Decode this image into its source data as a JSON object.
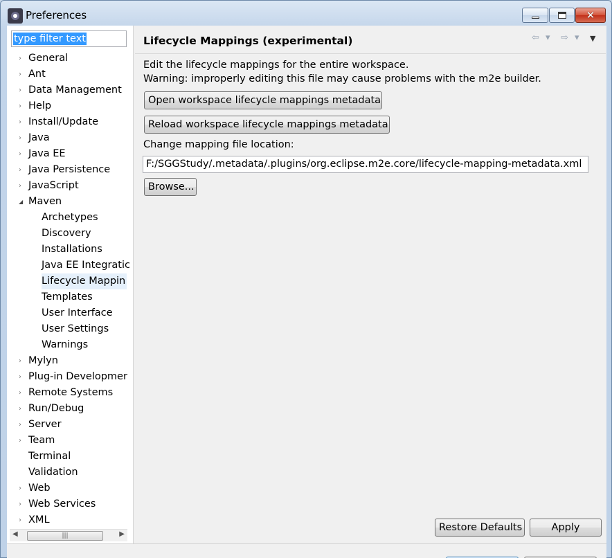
{
  "window": {
    "title": "Preferences",
    "min_icon": "minimize-icon",
    "max_icon": "maximize-icon",
    "close_icon": "close-icon",
    "close_glyph": "✕"
  },
  "filter": {
    "value": "type filter text"
  },
  "tree": {
    "items": [
      {
        "label": "General",
        "expander": "›",
        "child": false
      },
      {
        "label": "Ant",
        "expander": "›",
        "child": false
      },
      {
        "label": "Data Management",
        "expander": "›",
        "child": false
      },
      {
        "label": "Help",
        "expander": "›",
        "child": false
      },
      {
        "label": "Install/Update",
        "expander": "›",
        "child": false
      },
      {
        "label": "Java",
        "expander": "›",
        "child": false
      },
      {
        "label": "Java EE",
        "expander": "›",
        "child": false
      },
      {
        "label": "Java Persistence",
        "expander": "›",
        "child": false
      },
      {
        "label": "JavaScript",
        "expander": "›",
        "child": false
      },
      {
        "label": "Maven",
        "expander": "◢",
        "child": false
      },
      {
        "label": "Archetypes",
        "expander": "",
        "child": true
      },
      {
        "label": "Discovery",
        "expander": "",
        "child": true
      },
      {
        "label": "Installations",
        "expander": "",
        "child": true
      },
      {
        "label": "Java EE Integratic",
        "expander": "",
        "child": true
      },
      {
        "label": "Lifecycle Mappin",
        "expander": "",
        "child": true,
        "selected": true
      },
      {
        "label": "Templates",
        "expander": "",
        "child": true
      },
      {
        "label": "User Interface",
        "expander": "",
        "child": true
      },
      {
        "label": "User Settings",
        "expander": "",
        "child": true
      },
      {
        "label": "Warnings",
        "expander": "",
        "child": true
      },
      {
        "label": "Mylyn",
        "expander": "›",
        "child": false
      },
      {
        "label": "Plug-in Developmer",
        "expander": "›",
        "child": false
      },
      {
        "label": "Remote Systems",
        "expander": "›",
        "child": false
      },
      {
        "label": "Run/Debug",
        "expander": "›",
        "child": false
      },
      {
        "label": "Server",
        "expander": "›",
        "child": false
      },
      {
        "label": "Team",
        "expander": "›",
        "child": false
      },
      {
        "label": "Terminal",
        "expander": "",
        "child": false
      },
      {
        "label": "Validation",
        "expander": "",
        "child": false
      },
      {
        "label": "Web",
        "expander": "›",
        "child": false
      },
      {
        "label": "Web Services",
        "expander": "›",
        "child": false
      },
      {
        "label": "XML",
        "expander": "›",
        "child": false
      }
    ]
  },
  "scrollbar": {
    "left_arrow": "◀",
    "right_arrow": "▶",
    "grip": "|||"
  },
  "page": {
    "title": "Lifecycle Mappings (experimental)",
    "nav": {
      "back": "⇦",
      "back_menu": "▾",
      "forward": "⇨",
      "forward_menu": "▾",
      "view_menu": "▼"
    },
    "desc_line1": "Edit the lifecycle mappings for the entire workspace.",
    "desc_line2": "Warning: improperly editing this file may cause problems with the m2e builder.",
    "open_button": "Open workspace lifecycle mappings metadata",
    "reload_button": "Reload workspace lifecycle mappings metadata",
    "change_label": "Change mapping file location:",
    "path_value": "F:/SGGStudy/.metadata/.plugins/org.eclipse.m2e.core/lifecycle-mapping-metadata.xml",
    "browse_button": "Browse...",
    "restore_button": "Restore Defaults",
    "apply_button": "Apply"
  }
}
